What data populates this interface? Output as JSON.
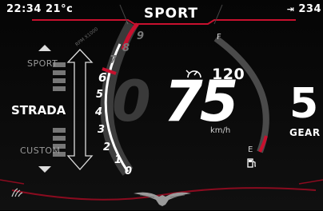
{
  "status_bar": {
    "time": "22:34",
    "temperature": "21°c",
    "mode_title": "SPORT",
    "odometer_partial": "234"
  },
  "ride_modes": {
    "items": [
      "SPORT",
      "STRADA",
      "CUSTOM"
    ],
    "selected": "STRADA"
  },
  "tachometer": {
    "label": "RPM X1000",
    "ticks": [
      "0",
      "1",
      "2",
      "3",
      "4",
      "5",
      "6",
      "7",
      "8",
      "9"
    ],
    "current_rpm_x1000": 6.2
  },
  "speed": {
    "value": "75",
    "ghost_digit": "0",
    "unit": "km/h"
  },
  "cruise": {
    "value": "120"
  },
  "gear": {
    "value": "5",
    "label": "GEAR"
  },
  "fuel": {
    "full_label": "F",
    "empty_label": "E",
    "level_fraction": 0.15
  },
  "icons": {
    "cruise": "cruise-control-icon",
    "fuel": "fuel-pump-icon",
    "traction": "traction-control-icon",
    "logo": "eagle-logo",
    "odometer": "odometer-icon"
  },
  "colors": {
    "accent_red": "#c8102e",
    "background": "#000000",
    "text": "#ffffff",
    "dim": "#3a3a3a"
  }
}
